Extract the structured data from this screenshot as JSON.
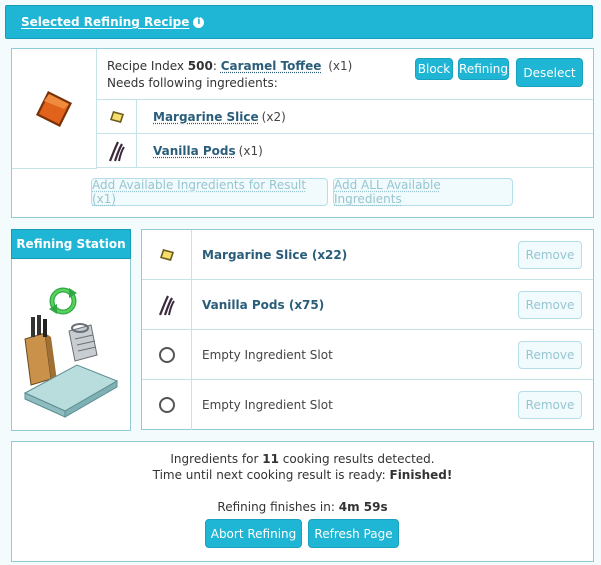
{
  "header": {
    "title": "Selected Refining Recipe",
    "info_icon": "info-icon"
  },
  "recipe": {
    "index_prefix": "Recipe Index",
    "index": "500",
    "name": "Caramel Toffee",
    "qty": "(x1)",
    "needs": "Needs following ingredients:",
    "buttons": {
      "block": "Block",
      "refining": "Refining",
      "deselect": "Deselect"
    },
    "ingredients": [
      {
        "name": "Margarine Slice",
        "qty": "(x2)",
        "icon": "margarine-icon"
      },
      {
        "name": "Vanilla Pods",
        "qty": "(x1)",
        "icon": "vanilla-icon"
      }
    ],
    "add_result": "Add Available Ingredients for Result (x1)",
    "add_all": "Add ALL Available Ingredients"
  },
  "station": {
    "title": "Refining Station",
    "slots": [
      {
        "label": "Margarine Slice (x22)",
        "icon": "margarine-icon",
        "remove": "Remove"
      },
      {
        "label": "Vanilla Pods (x75)",
        "icon": "vanilla-icon",
        "remove": "Remove"
      },
      {
        "label": "Empty Ingredient Slot",
        "icon": "empty-slot-icon",
        "remove": "Remove"
      },
      {
        "label": "Empty Ingredient Slot",
        "icon": "empty-slot-icon",
        "remove": "Remove"
      }
    ]
  },
  "status": {
    "detected_pre": "Ingredients for",
    "detected_count": "11",
    "detected_post": "cooking results detected.",
    "next_pre": "Time until next cooking result is ready:",
    "next_value": "Finished!",
    "finish_pre": "Refining finishes in:",
    "finish_value": "4m 59s",
    "abort": "Abort Refining",
    "refresh": "Refresh Page"
  }
}
